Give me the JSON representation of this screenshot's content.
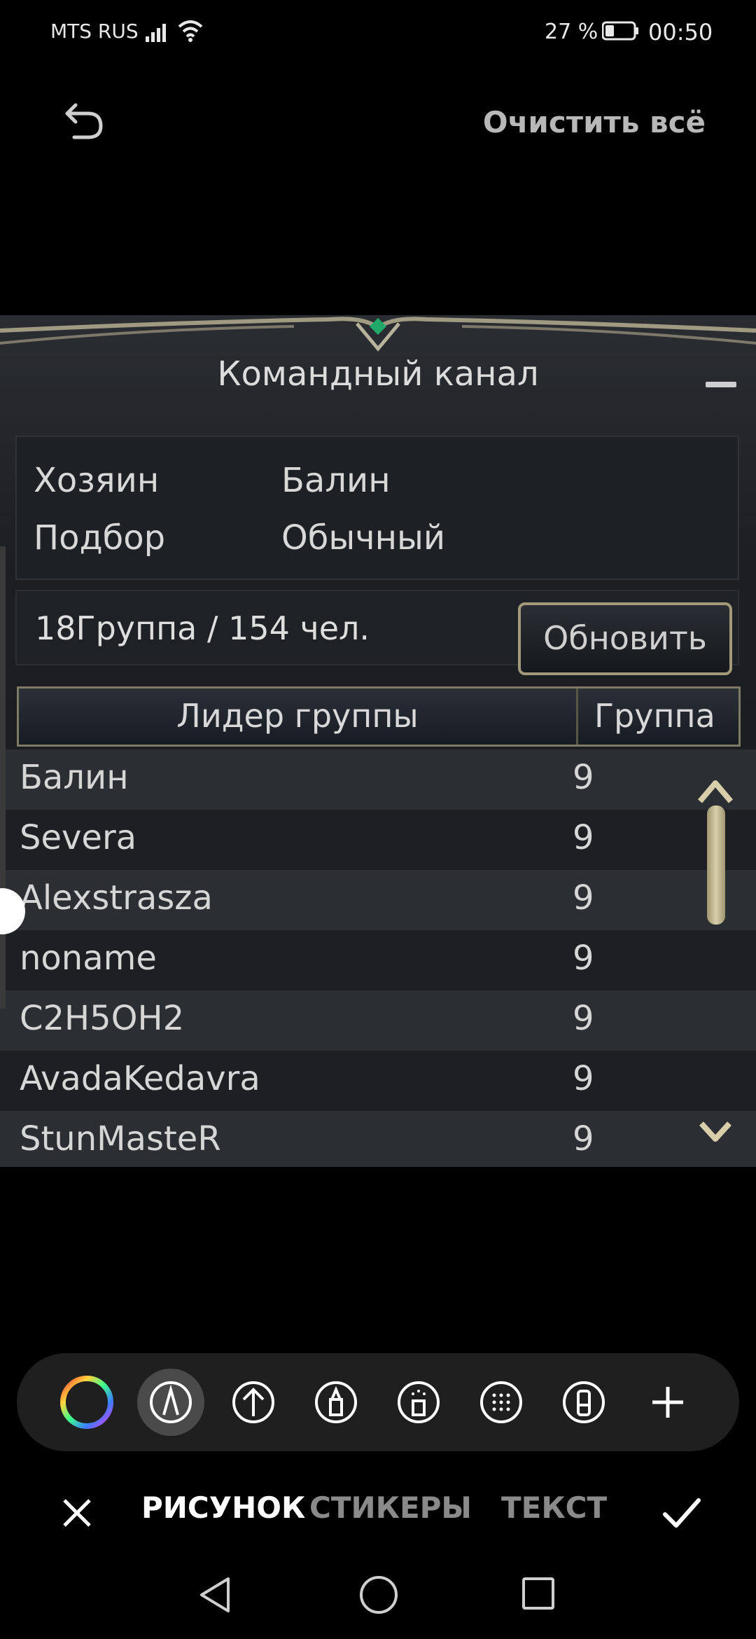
{
  "status_bar": {
    "carrier": "MTS RUS",
    "battery_percent": "27 %",
    "time": "00:50",
    "icons": [
      "signal-icon",
      "wifi-icon",
      "battery-icon"
    ]
  },
  "top_bar": {
    "undo_icon": "undo-icon",
    "clear_all": "Очистить всё"
  },
  "game_window": {
    "title": "Командный канал",
    "info": [
      {
        "label": "Хозяин",
        "value": "Балин"
      },
      {
        "label": "Подбор",
        "value": "Обычный"
      }
    ],
    "summary": "18Группа / 154 чел.",
    "refresh_button": "Обновить",
    "table": {
      "headers": [
        "Лидер группы",
        "Группа"
      ],
      "rows": [
        {
          "name": "Балин",
          "group": "9"
        },
        {
          "name": "Severa",
          "group": "9"
        },
        {
          "name": "Alexstrasza",
          "group": "9"
        },
        {
          "name": "noname",
          "group": "9"
        },
        {
          "name": "C2H5OH2",
          "group": "9"
        },
        {
          "name": "AvadaKedavra",
          "group": "9"
        },
        {
          "name": "StunMasteR",
          "group": "9"
        }
      ]
    }
  },
  "toolbar": {
    "tools": [
      "color-wheel-icon",
      "pen-icon",
      "arrow-up-icon",
      "marker-icon",
      "spray-icon",
      "mosaic-icon",
      "eraser-icon",
      "plus-icon"
    ],
    "active_tool": "pen-icon"
  },
  "mode_tabs": {
    "draw": "РИСУНОК",
    "stickers": "СТИКЕРЫ",
    "text": "ТЕКСТ",
    "active": "РИСУНОК"
  },
  "nav_bar": [
    "back-icon",
    "home-icon",
    "recent-apps-icon"
  ]
}
